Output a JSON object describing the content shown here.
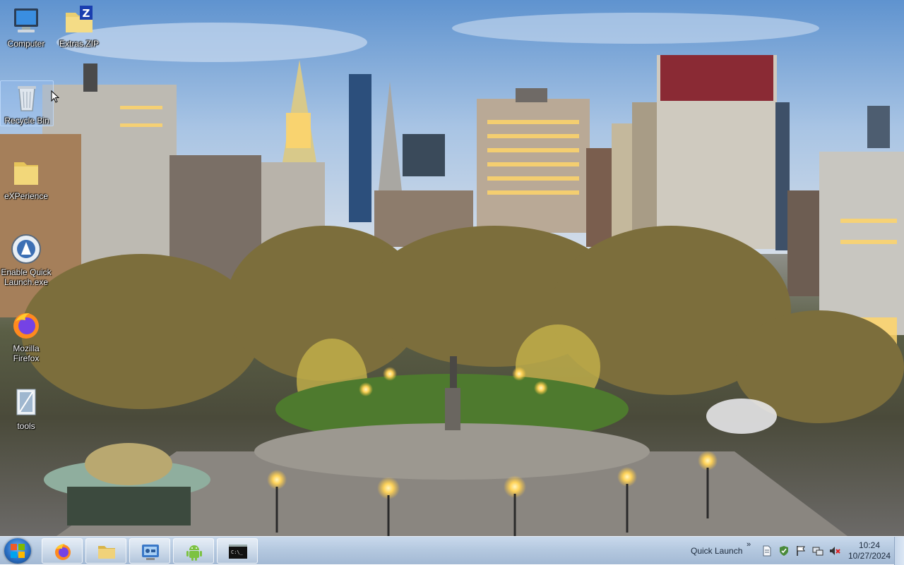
{
  "desktop": {
    "icons": [
      {
        "label": "Computer",
        "icon": "computer-icon"
      },
      {
        "label": "Extras.ZIP",
        "icon": "zip-folder-icon"
      },
      {
        "label": "Recycle Bin",
        "icon": "recycle-bin-icon"
      },
      {
        "label": "eXPerience",
        "icon": "folder-icon"
      },
      {
        "label": "Enable Quick Launch.exe",
        "icon": "app-exe-icon"
      },
      {
        "label": "Mozilla Firefox",
        "icon": "firefox-icon"
      },
      {
        "label": "tools",
        "icon": "tools-folder-icon"
      }
    ],
    "wallpaper": "city-park-dusk"
  },
  "taskbar": {
    "start": "start-orb-icon",
    "pinned": [
      {
        "name": "firefox",
        "icon": "firefox-icon"
      },
      {
        "name": "file-explorer",
        "icon": "folder-icon"
      },
      {
        "name": "control-panel",
        "icon": "control-panel-icon"
      },
      {
        "name": "android",
        "icon": "android-icon"
      },
      {
        "name": "command-prompt",
        "icon": "terminal-icon"
      }
    ],
    "quick_launch_label": "Quick Launch",
    "chevron": "»",
    "tray_icons": [
      "document-icon",
      "shield-check-icon",
      "flag-icon",
      "network-icon",
      "volume-muted-icon"
    ],
    "clock": {
      "time": "10:24",
      "date": "10/27/2024"
    }
  },
  "colors": {
    "taskbar": "#b5c9e0",
    "text": "#1d2b3d"
  }
}
